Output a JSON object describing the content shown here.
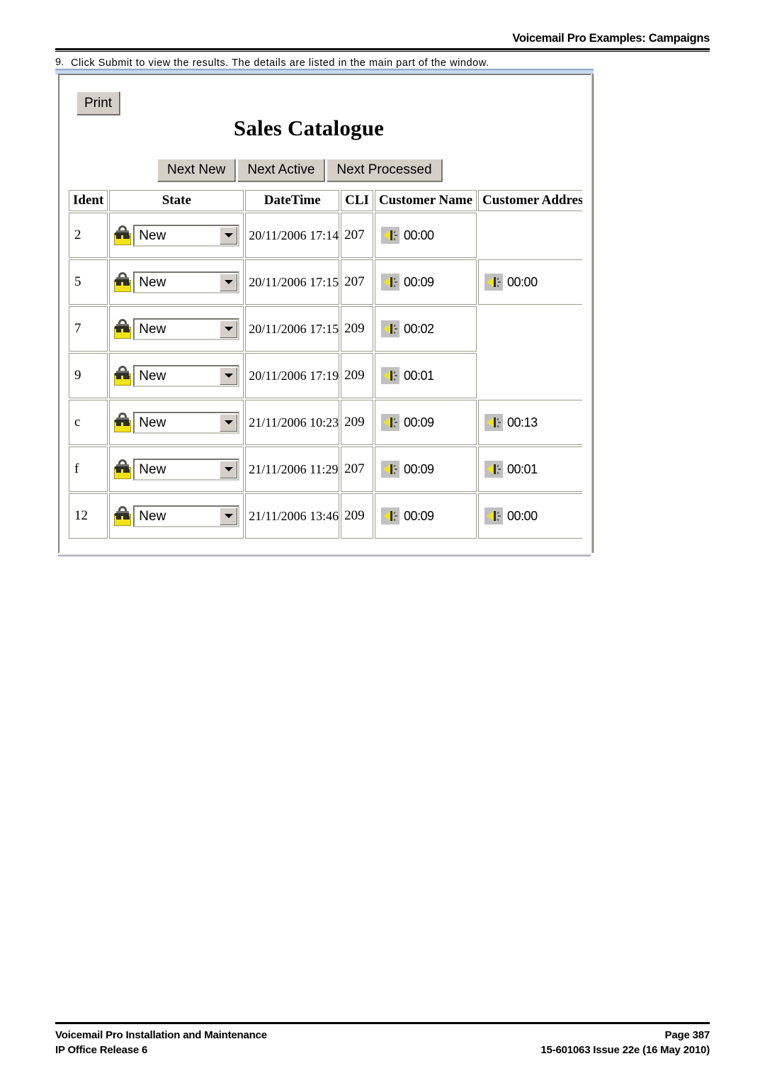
{
  "header": {
    "title": "Voicemail Pro Examples: Campaigns"
  },
  "step": {
    "number": "9.",
    "text": "Click Submit to view the results. The details are listed in the main part of the window."
  },
  "window": {
    "print_button": "Print",
    "catalogue_title": "Sales Catalogue",
    "nav_buttons": [
      {
        "label": "Next New",
        "name": "next-new-button"
      },
      {
        "label": "Next Active",
        "name": "next-active-button"
      },
      {
        "label": "Next Processed",
        "name": "next-processed-button"
      }
    ],
    "table": {
      "headers": {
        "ident": "Ident",
        "state": "State",
        "datetime": "DateTime",
        "cli": "CLI",
        "customer_name": "Customer Name",
        "customer_address": "Customer Address"
      },
      "rows": [
        {
          "ident": "2",
          "state": "New",
          "datetime": "20/11/2006 17:14",
          "cli": "207",
          "customer_name": "00:00",
          "customer_address": ""
        },
        {
          "ident": "5",
          "state": "New",
          "datetime": "20/11/2006 17:15",
          "cli": "207",
          "customer_name": "00:09",
          "customer_address": "00:00"
        },
        {
          "ident": "7",
          "state": "New",
          "datetime": "20/11/2006 17:15",
          "cli": "209",
          "customer_name": "00:02",
          "customer_address": ""
        },
        {
          "ident": "9",
          "state": "New",
          "datetime": "20/11/2006 17:19",
          "cli": "209",
          "customer_name": "00:01",
          "customer_address": ""
        },
        {
          "ident": "c",
          "state": "New",
          "datetime": "21/11/2006 10:23",
          "cli": "209",
          "customer_name": "00:09",
          "customer_address": "00:13"
        },
        {
          "ident": "f",
          "state": "New",
          "datetime": "21/11/2006 11:29",
          "cli": "207",
          "customer_name": "00:09",
          "customer_address": "00:01"
        },
        {
          "ident": "12",
          "state": "New",
          "datetime": "21/11/2006 13:46",
          "cli": "209",
          "customer_name": "00:09",
          "customer_address": "00:00"
        }
      ]
    }
  },
  "footer": {
    "left_line1": "Voicemail Pro Installation and Maintenance",
    "left_line2": "IP Office Release 6",
    "right_line1": "Page 387",
    "right_line2": "15-601063 Issue 22e (16 May 2010)"
  },
  "colors": {
    "lock_yellow": "#F2E21C",
    "speaker_yellow": "#F2E21C",
    "button_face": "#D4D0C8",
    "titlebar_blue": "#B9CCE4",
    "table_border": "#9C9C8E"
  }
}
